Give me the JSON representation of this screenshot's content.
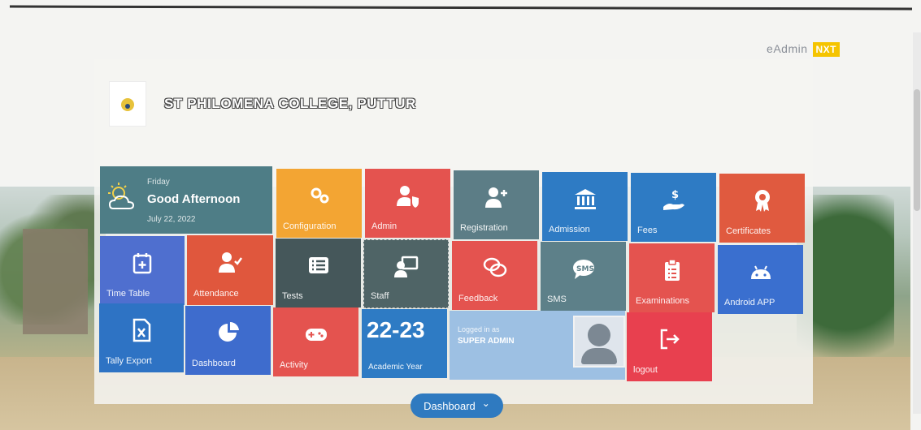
{
  "brand": {
    "name": "eAdmin",
    "badge": "NXT"
  },
  "college": {
    "name": "ST PHILOMENA COLLEGE, PUTTUR"
  },
  "greeting": {
    "day": "Friday",
    "message": "Good Afternoon",
    "date": "July 22, 2022"
  },
  "tiles": {
    "configuration": "Configuration",
    "admin": "Admin",
    "registration": "Registration",
    "admission": "Admission",
    "fees": "Fees",
    "certificates": "Certificates",
    "time_table": "Time Table",
    "attendance": "Attendance",
    "tests": "Tests",
    "staff": "Staff",
    "feedback": "Feedback",
    "sms": "SMS",
    "examinations": "Examinations",
    "android_app": "Android APP",
    "tally_export": "Tally Export",
    "dashboard": "Dashboard",
    "activity": "Activity",
    "logout": "logout"
  },
  "academic_year": {
    "value": "22-23",
    "label": "Academic Year"
  },
  "logged_in": {
    "prefix": "Logged in as",
    "role": "SUPER ADMIN"
  },
  "bottom_toggle": {
    "label": "Dashboard"
  },
  "icons": [
    "sun-cloud-icon",
    "gears-icon",
    "user-shield-icon",
    "user-plus-icon",
    "bank-icon",
    "hand-money-icon",
    "award-icon",
    "calendar-plus-icon",
    "user-check-icon",
    "list-icon",
    "chalkboard-user-icon",
    "chat-bubbles-icon",
    "sms-bubble-icon",
    "clipboard-list-icon",
    "android-icon",
    "excel-file-icon",
    "pie-chart-icon",
    "gamepad-icon",
    "avatar-icon",
    "sign-out-icon",
    "chevron-down-icon"
  ],
  "colors": {
    "greeting": "#4e7d86",
    "configuration": "#f3a533",
    "admin": "#e4534f",
    "registration": "#5c7d86",
    "admission": "#2e7bc4",
    "fees": "#2e7bc4",
    "certificates": "#e05a3f",
    "time_table": "#4f6fcf",
    "attendance": "#e0573d",
    "tests": "#45575a",
    "staff": "#4f6466",
    "feedback": "#e4534f",
    "sms": "#5d8089",
    "examinations": "#e4534f",
    "android_app": "#3a6fcf",
    "tally_export": "#2e73c4",
    "dashboard": "#3e6ccd",
    "activity": "#e4534f",
    "academic_year": "#2e7bc4",
    "logged_in": "#9dc0e3",
    "logout": "#e8404f",
    "bottom_toggle": "#2f7ac0",
    "brand_badge": "#f5c400"
  }
}
